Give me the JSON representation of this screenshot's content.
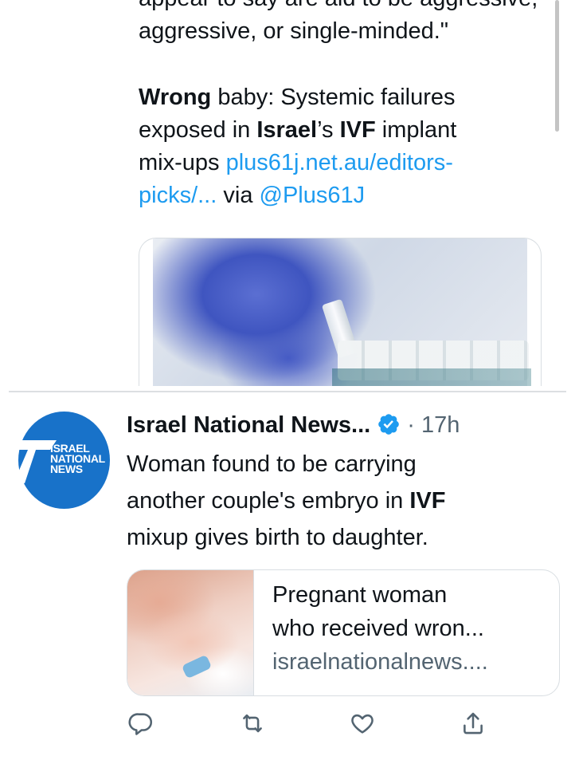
{
  "tweet1": {
    "cut_line": "appear to say are aid to be aggressive,",
    "line2": "aggressive, or single-minded.\"",
    "headline_bold1": "Wrong",
    "headline_text1": " baby: Systemic failures",
    "headline_text2": "exposed in ",
    "headline_bold2": "Israel",
    "headline_text3": "’s ",
    "headline_bold3": "IVF",
    "headline_text4": " implant",
    "headline_text5": "mix-ups ",
    "link1": "plus61j.net.au/editors-",
    "link2": "picks/...",
    "via": " via ",
    "mention": "@Plus61J"
  },
  "tweet2": {
    "avatar_text_1": "ISRAEL",
    "avatar_text_2": "NATIONAL",
    "avatar_text_3": "NEWS",
    "author": "Israel National News...",
    "separator_dot": " · ",
    "time": "17h",
    "more": "···",
    "body_line1": "Woman found to be carrying",
    "body_line2a": "another couple's embryo in ",
    "body_line2b": "IVF",
    "body_line3": "mixup gives birth to daughter.",
    "card": {
      "title_line1": "Pregnant woman",
      "title_line2": "who received wron...",
      "domain": "israelnationalnews...."
    }
  },
  "actions": [
    "reply-icon",
    "retweet-icon",
    "like-icon",
    "share-icon"
  ],
  "colors": {
    "link": "#1d9bf0",
    "verified": "#1d9bf0",
    "avatar": "#1872c9",
    "muted": "#536471",
    "text": "#0f1419"
  }
}
